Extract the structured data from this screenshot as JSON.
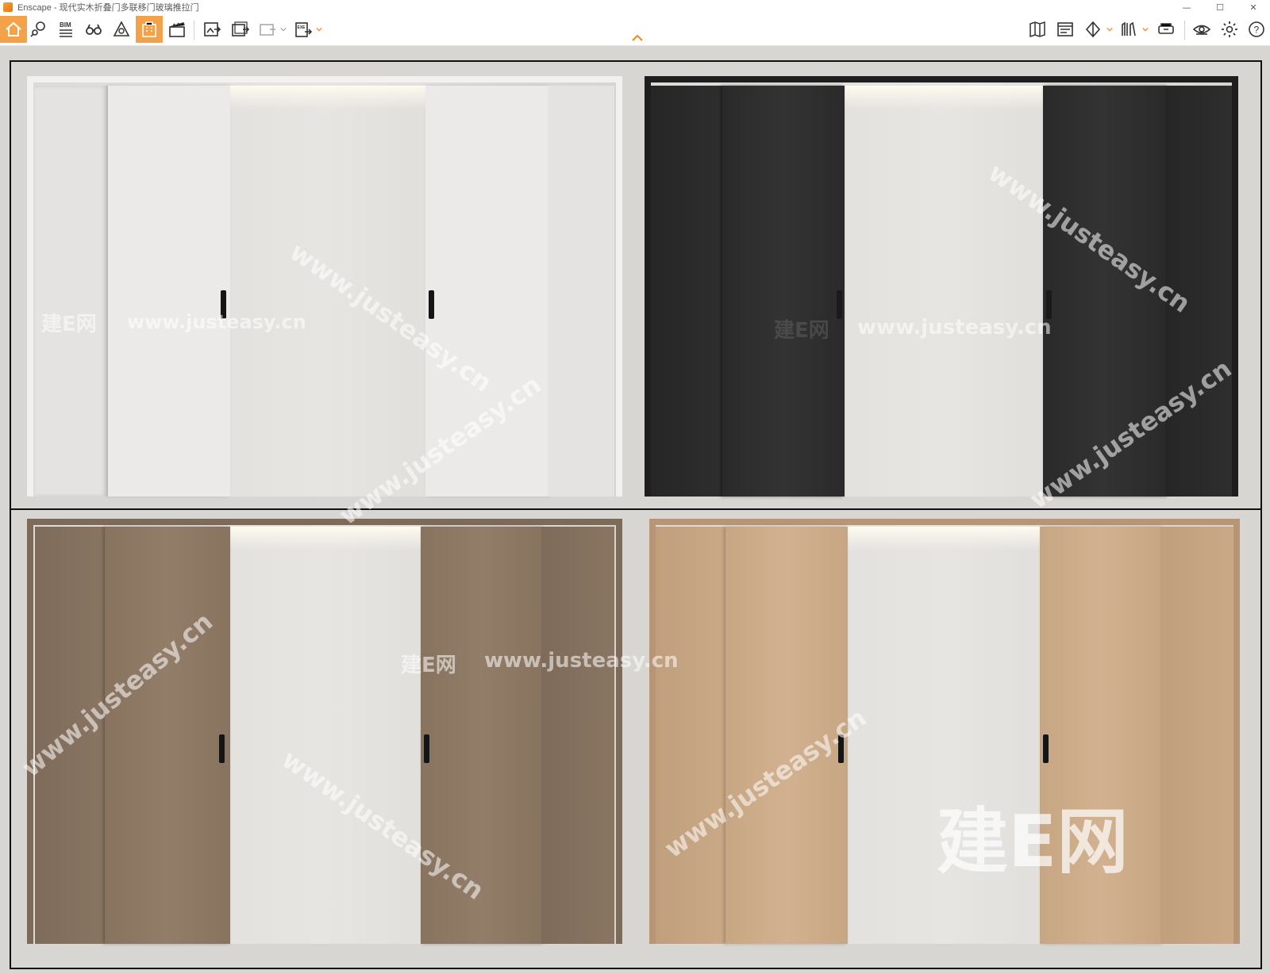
{
  "window": {
    "title": "Enscape - 现代实木折叠门多联移门玻璃推拉门",
    "controls": [
      "—",
      "☐",
      "✕"
    ]
  },
  "toolbar": {
    "buttons": [
      {
        "name": "home",
        "active": true
      },
      {
        "name": "views-pin"
      },
      {
        "name": "bim",
        "label": "BIM"
      },
      {
        "name": "binoculars"
      },
      {
        "name": "asset-library"
      },
      {
        "name": "materials",
        "active": true
      },
      {
        "name": "video-clapper"
      },
      {
        "name": "screenshot-export"
      },
      {
        "name": "batch-render"
      },
      {
        "name": "export-panorama"
      },
      {
        "name": "exe-export",
        "label": "EXE"
      },
      {
        "name": "map"
      },
      {
        "name": "web-standalone"
      },
      {
        "name": "cube"
      },
      {
        "name": "headset"
      },
      {
        "name": "vr-headset"
      },
      {
        "name": "visual-settings"
      },
      {
        "name": "settings"
      },
      {
        "name": "help",
        "label": "?"
      }
    ]
  },
  "scene": {
    "panels": [
      {
        "name": "white-doors",
        "door_color": "#e9e8e6",
        "frame_color": "#f2f1ef",
        "edge_color": "#d7d6d3"
      },
      {
        "name": "black-doors",
        "door_color": "#2c2c2c",
        "frame_color": "#1e1e1e",
        "edge_color": "#151515"
      },
      {
        "name": "walnut-doors",
        "door_color": "#8c7764",
        "frame_color": "#7e6a58",
        "edge_color": "#6b5a4a"
      },
      {
        "name": "oak-doors",
        "door_color": "#c9a885",
        "frame_color": "#b89574",
        "edge_color": "#a3825f"
      }
    ],
    "watermarks": [
      {
        "text": "建E网"
      },
      {
        "text": "www.justeasy.cn"
      }
    ]
  },
  "colors": {
    "accent": "#f3a24a",
    "frame_line": "#111111",
    "wall": "#e2e0dc"
  }
}
